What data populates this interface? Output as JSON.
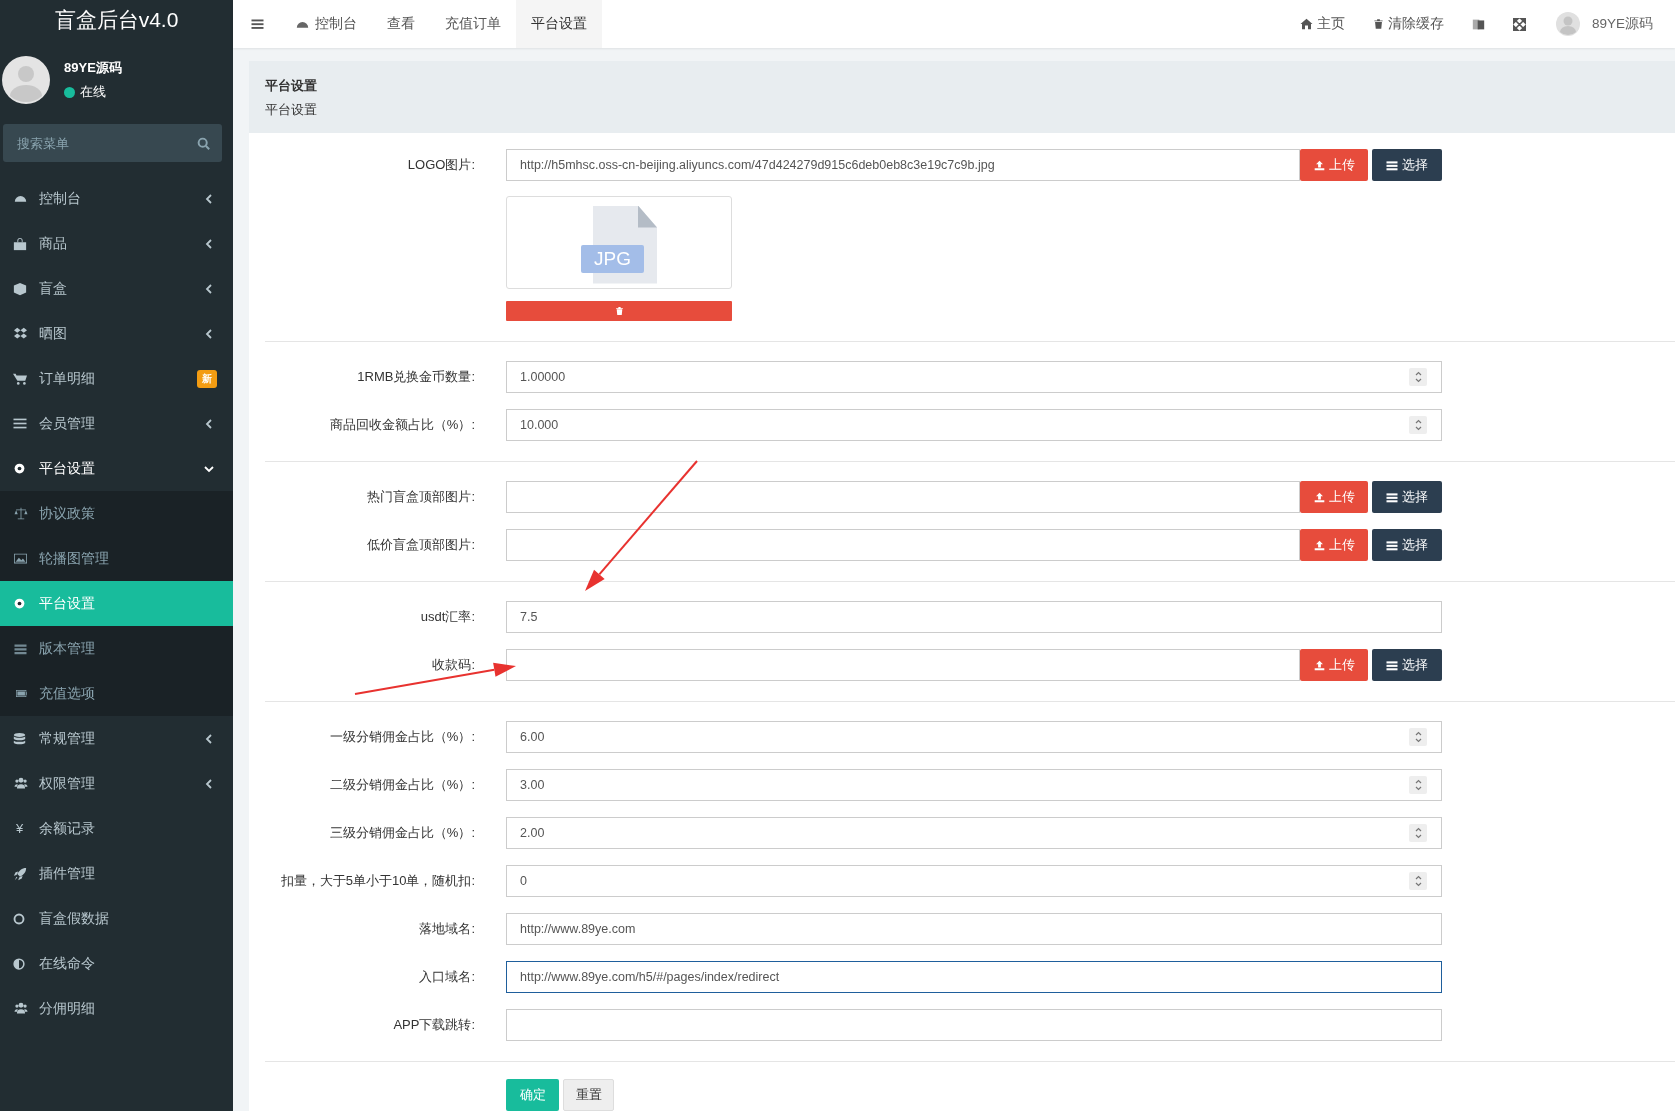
{
  "sidebar": {
    "title": "盲盒后台v4.0",
    "user": {
      "name": "89YE源码",
      "status": "在线"
    },
    "search": {
      "placeholder": "搜索菜单"
    },
    "items": [
      {
        "label": "控制台",
        "selected": false,
        "expanded": false
      },
      {
        "label": "商品",
        "selected": false,
        "expanded": false
      },
      {
        "label": "盲盒",
        "selected": false,
        "expanded": false
      },
      {
        "label": "晒图",
        "selected": false,
        "expanded": false
      },
      {
        "label": "订单明细",
        "selected": false,
        "badge": "新"
      },
      {
        "label": "会员管理",
        "selected": false,
        "expanded": false
      },
      {
        "label": "平台设置",
        "selected": false,
        "expanded": true,
        "children": [
          {
            "label": "协议政策",
            "selected": false
          },
          {
            "label": "轮播图管理",
            "selected": false
          },
          {
            "label": "平台设置",
            "selected": true
          },
          {
            "label": "版本管理",
            "selected": false
          },
          {
            "label": "充值选项",
            "selected": false
          }
        ]
      },
      {
        "label": "常规管理",
        "selected": false,
        "expanded": false
      },
      {
        "label": "权限管理",
        "selected": false,
        "expanded": false
      },
      {
        "label": "余额记录",
        "selected": false,
        "icon_text": "¥"
      },
      {
        "label": "插件管理",
        "selected": false
      },
      {
        "label": "盲盒假数据",
        "selected": false
      },
      {
        "label": "在线命令",
        "selected": false
      },
      {
        "label": "分佣明细",
        "selected": false
      }
    ]
  },
  "topbar": {
    "tabs": [
      {
        "label": "控制台",
        "selected": false
      },
      {
        "label": "查看",
        "selected": false
      },
      {
        "label": "充值订单",
        "selected": false
      },
      {
        "label": "平台设置",
        "selected": true
      }
    ],
    "links": [
      "主页",
      "清除缓存"
    ],
    "user": "89YE源码"
  },
  "header": {
    "title": "平台设置",
    "subtitle": "平台设置"
  },
  "form": {
    "sections": [
      {
        "fields": [
          {
            "kind": "upload",
            "label": "LOGO图片:",
            "value": "http://h5mhsc.oss-cn-beijing.aliyuncs.com/47d424279d915c6deb0eb8c3e19c7c9b.jpg",
            "focused": false,
            "upload": "上传",
            "select": "选择",
            "preview": "JPG"
          }
        ]
      },
      {
        "fields": [
          {
            "kind": "number",
            "label": "1RMB兑换金币数量:",
            "value": "1.00000",
            "focused": false
          },
          {
            "kind": "number",
            "label": "商品回收金额占比（%）:",
            "value": "10.000",
            "focused": false
          }
        ]
      },
      {
        "fields": [
          {
            "kind": "upload",
            "label": "热门盲盒顶部图片:",
            "focused": false,
            "upload": "上传",
            "select": "选择"
          },
          {
            "kind": "upload",
            "label": "低价盲盒顶部图片:",
            "focused": false,
            "upload": "上传",
            "select": "选择"
          }
        ]
      },
      {
        "fields": [
          {
            "kind": "text",
            "label": "usdt汇率:",
            "value": "7.5",
            "focused": false
          },
          {
            "kind": "upload",
            "label": "收款码:",
            "focused": false,
            "upload": "上传",
            "select": "选择"
          }
        ]
      },
      {
        "fields": [
          {
            "kind": "number",
            "label": "一级分销佣金占比（%）:",
            "value": "6.00",
            "focused": false
          },
          {
            "kind": "number",
            "label": "二级分销佣金占比（%）:",
            "value": "3.00",
            "focused": false
          },
          {
            "kind": "number",
            "label": "三级分销佣金占比（%）:",
            "value": "2.00",
            "focused": false
          },
          {
            "kind": "number",
            "label": "扣量，大于5单小于10单，随机扣:",
            "value": "0",
            "focused": false
          },
          {
            "kind": "text",
            "label": "落地域名:",
            "value": "http://www.89ye.com",
            "focused": false
          },
          {
            "kind": "text",
            "label": "入口域名:",
            "value": "http://www.89ye.com/h5/#/pages/index/redirect",
            "focused": true
          },
          {
            "kind": "text",
            "label": "APP下载跳转:",
            "focused": false
          }
        ]
      }
    ],
    "submit": "确定",
    "reset": "重置"
  },
  "annotations": [
    {
      "kind": "arrow"
    },
    {
      "kind": "arrow"
    }
  ]
}
